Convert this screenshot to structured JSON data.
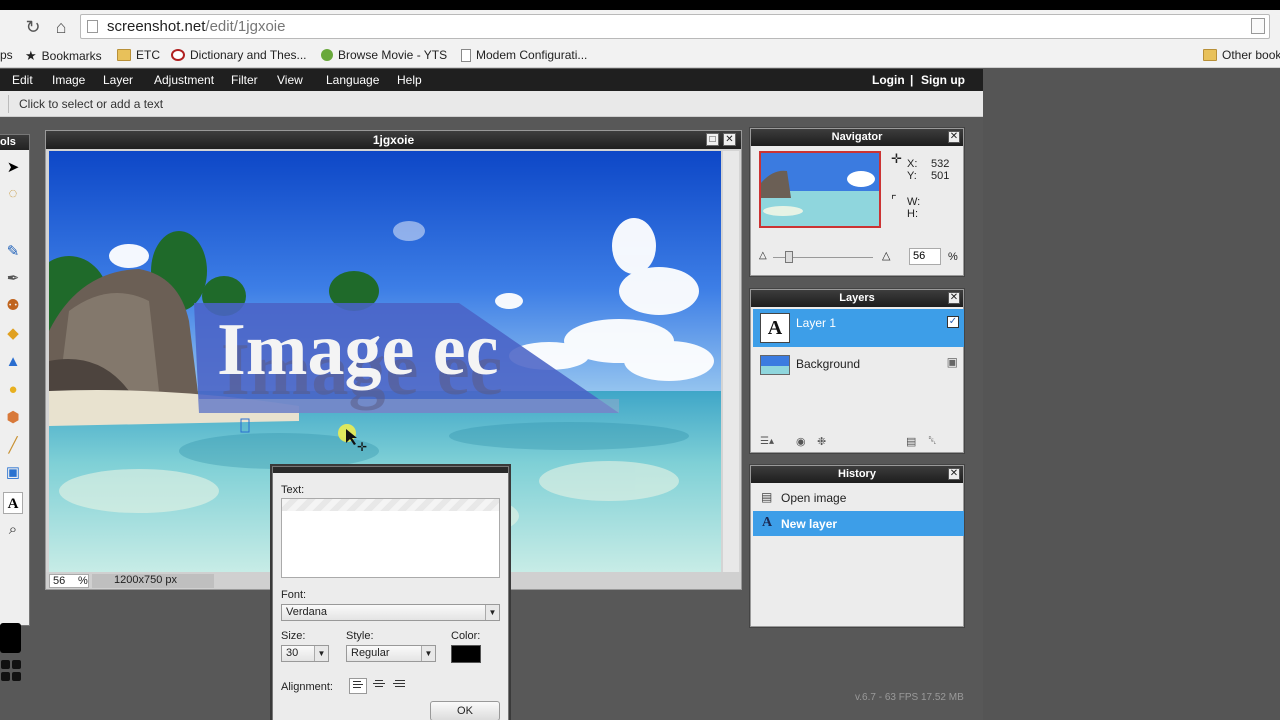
{
  "browser": {
    "url_host": "screenshot.net",
    "url_path": "/edit/1jgxoie",
    "bookmarks": [
      {
        "label": "ps",
        "icon": "apps-icon"
      },
      {
        "label": "Bookmarks",
        "icon": "star-icon"
      },
      {
        "label": "ETC",
        "icon": "folder-icon"
      },
      {
        "label": "Dictionary and Thes...",
        "icon": "dictionary-icon"
      },
      {
        "label": "Browse Movie - YTS",
        "icon": "yts-icon"
      },
      {
        "label": "Modem Configurati...",
        "icon": "page-icon"
      }
    ],
    "other_bookmarks": "Other book"
  },
  "menubar": {
    "items": [
      "Edit",
      "Image",
      "Layer",
      "Adjustment",
      "Filter",
      "View",
      "Language",
      "Help"
    ],
    "login": "Login",
    "separator": "|",
    "signup": "Sign up"
  },
  "options": {
    "hint": "Click to select or add a text"
  },
  "tools_panel": {
    "title": "ols"
  },
  "document": {
    "title": "1jgxoie",
    "overlay_text": "Image ec",
    "zoom": "56",
    "zoom_unit": "%",
    "dimensions": "1200x750 px"
  },
  "navigator": {
    "title": "Navigator",
    "x_label": "X:",
    "x_value": "532",
    "y_label": "Y:",
    "y_value": "501",
    "w_label": "W:",
    "h_label": "H:",
    "zoom": "56",
    "zoom_unit": "%"
  },
  "layers": {
    "title": "Layers",
    "items": [
      {
        "name": "Layer 1",
        "selected": true,
        "icon": "text-layer-icon",
        "thumb_letter": "A"
      },
      {
        "name": "Background",
        "selected": false,
        "icon": "image-layer-icon"
      }
    ]
  },
  "history": {
    "title": "History",
    "items": [
      {
        "label": "Open image",
        "selected": false,
        "icon": "open-image-icon"
      },
      {
        "label": "New layer",
        "selected": true,
        "icon": "text-tool-icon"
      }
    ]
  },
  "text_dialog": {
    "text_label": "Text:",
    "font_label": "Font:",
    "font_value": "Verdana",
    "size_label": "Size:",
    "size_value": "30",
    "style_label": "Style:",
    "style_value": "Regular",
    "color_label": "Color:",
    "color_value": "#000000",
    "alignment_label": "Alignment:",
    "ok_label": "OK"
  },
  "version": "v.6.7 - 63 FPS 17.52 MB",
  "colors": {
    "selection": "#3d9ee8",
    "menubar": "#1f1f1f",
    "workspace": "#585858",
    "text_overlay_band": "#4a63c6"
  }
}
